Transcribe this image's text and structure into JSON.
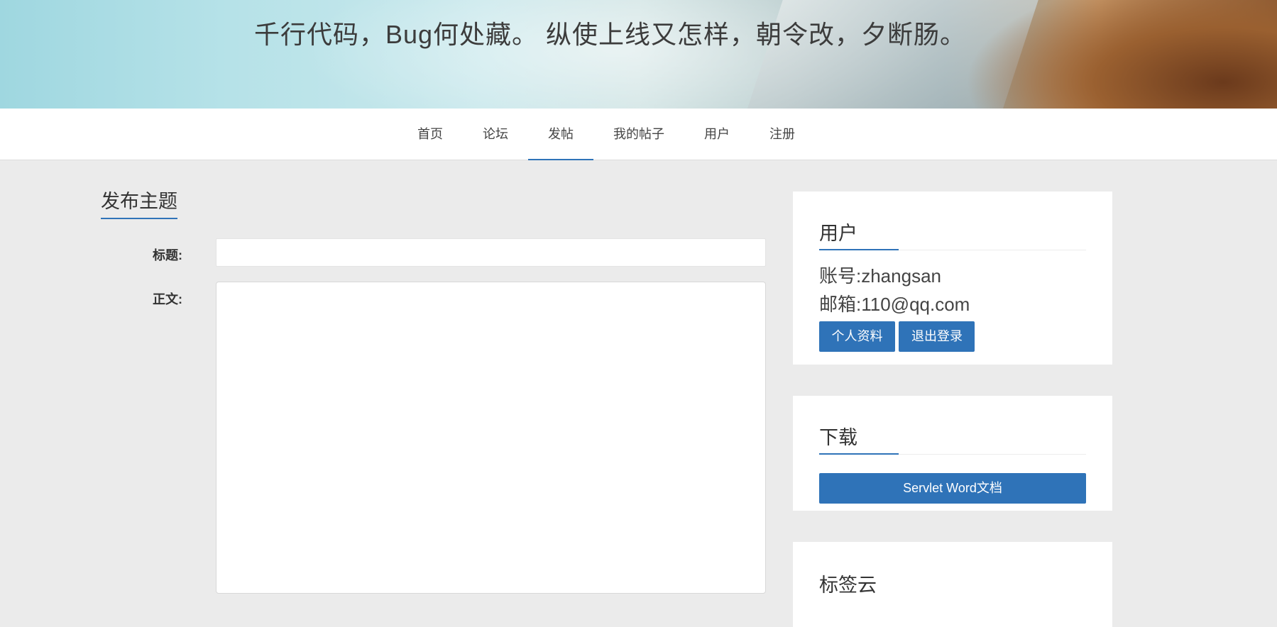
{
  "banner": {
    "slogan": "千行代码，Bug何处藏。 纵使上线又怎样，朝令改，夕断肠。"
  },
  "nav": {
    "items": [
      {
        "label": "首页"
      },
      {
        "label": "论坛"
      },
      {
        "label": "发帖",
        "active": true
      },
      {
        "label": "我的帖子"
      },
      {
        "label": "用户"
      },
      {
        "label": "注册"
      }
    ]
  },
  "post_form": {
    "heading": "发布主题",
    "title_label": "标题:",
    "title_value": "",
    "body_label": "正文:",
    "body_value": ""
  },
  "sidebar": {
    "user_card": {
      "heading": "用户",
      "account": "账号:zhangsan",
      "email": "邮箱:110@qq.com",
      "profile_button": "个人资料",
      "logout_button": "退出登录"
    },
    "download_card": {
      "heading": "下载",
      "download_button": "Servlet Word文档"
    },
    "tag_card": {
      "heading": "标签云"
    }
  },
  "colors": {
    "accent": "#2f73b8",
    "background": "#ebebeb"
  }
}
